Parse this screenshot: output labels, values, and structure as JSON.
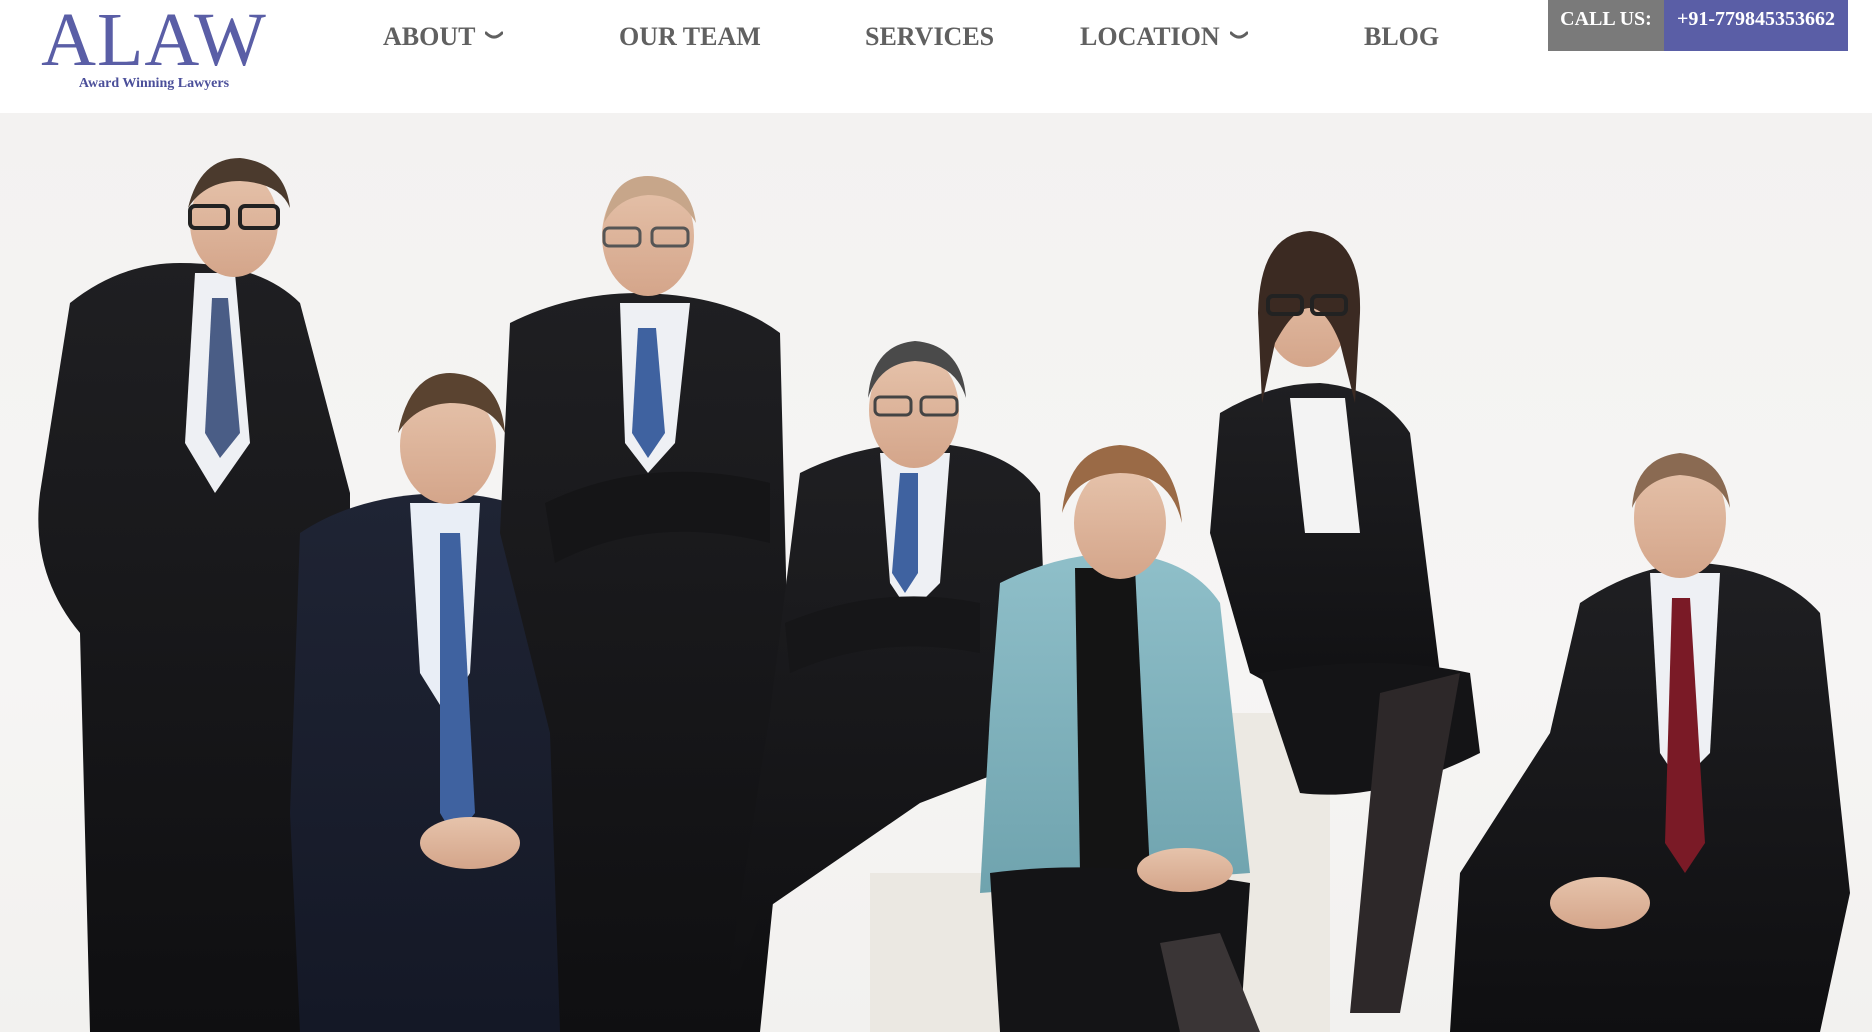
{
  "logo": {
    "title": "ALAW",
    "tagline": "Award Winning Lawyers"
  },
  "nav": {
    "items": [
      {
        "label": "ABOUT",
        "has_dropdown": true
      },
      {
        "label": "OUR TEAM",
        "has_dropdown": false
      },
      {
        "label": "SERVICES",
        "has_dropdown": false
      },
      {
        "label": "LOCATION",
        "has_dropdown": true
      },
      {
        "label": "BLOG",
        "has_dropdown": false
      }
    ]
  },
  "call": {
    "label": "CALL US:",
    "number": "+91-779845353662"
  },
  "hero": {
    "icon": "team-photo"
  },
  "colors": {
    "brand": "#5a5ea6",
    "nav_text": "#606060",
    "call_label_bg": "#7a7a7a",
    "call_number_bg": "#5a5ea6"
  }
}
